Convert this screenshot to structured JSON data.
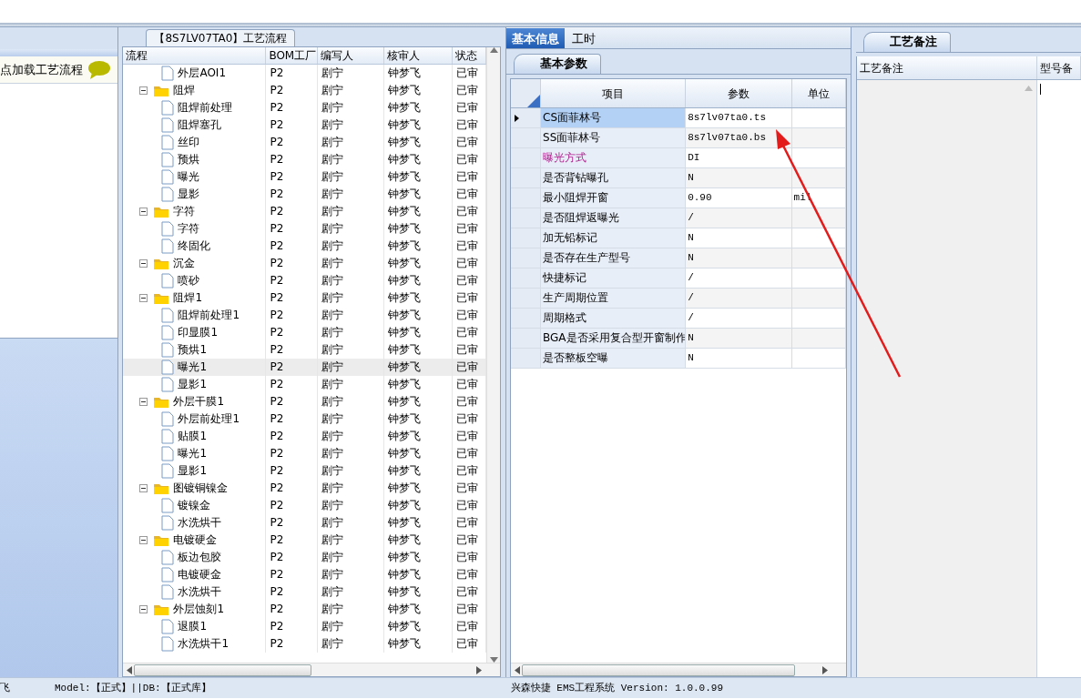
{
  "left_panel": {
    "hint": "点加载工艺流程"
  },
  "flow_panel": {
    "title": "【8S7LV07TA0】工艺流程",
    "columns": [
      "流程",
      "BOM工厂",
      "编写人",
      "核审人",
      "状态"
    ],
    "rows": [
      {
        "label": "外层AOI1",
        "kind": "leaf",
        "bom": "P2",
        "writer": "剧宁",
        "reviewer": "钟梦飞",
        "status": "已审",
        "selected": false
      },
      {
        "label": "阻焊",
        "kind": "group",
        "expanded": true,
        "bom": "P2",
        "writer": "剧宁",
        "reviewer": "钟梦飞",
        "status": "已审",
        "selected": false,
        "children": [
          {
            "label": "阻焊前处理",
            "kind": "leaf",
            "bom": "P2",
            "writer": "剧宁",
            "reviewer": "钟梦飞",
            "status": "已审",
            "selected": false
          },
          {
            "label": "阻焊塞孔",
            "kind": "leaf",
            "bom": "P2",
            "writer": "剧宁",
            "reviewer": "钟梦飞",
            "status": "已审",
            "selected": false
          },
          {
            "label": "丝印",
            "kind": "leaf",
            "bom": "P2",
            "writer": "剧宁",
            "reviewer": "钟梦飞",
            "status": "已审",
            "selected": false
          },
          {
            "label": "预烘",
            "kind": "leaf",
            "bom": "P2",
            "writer": "剧宁",
            "reviewer": "钟梦飞",
            "status": "已审",
            "selected": false
          },
          {
            "label": "曝光",
            "kind": "leaf",
            "bom": "P2",
            "writer": "剧宁",
            "reviewer": "钟梦飞",
            "status": "已审",
            "selected": false
          },
          {
            "label": "显影",
            "kind": "leaf",
            "bom": "P2",
            "writer": "剧宁",
            "reviewer": "钟梦飞",
            "status": "已审",
            "selected": false
          }
        ]
      },
      {
        "label": "字符",
        "kind": "group",
        "expanded": true,
        "bom": "P2",
        "writer": "剧宁",
        "reviewer": "钟梦飞",
        "status": "已审",
        "selected": false,
        "children": [
          {
            "label": "字符",
            "kind": "leaf",
            "bom": "P2",
            "writer": "剧宁",
            "reviewer": "钟梦飞",
            "status": "已审",
            "selected": false
          },
          {
            "label": "终固化",
            "kind": "leaf",
            "bom": "P2",
            "writer": "剧宁",
            "reviewer": "钟梦飞",
            "status": "已审",
            "selected": false
          }
        ]
      },
      {
        "label": "沉金",
        "kind": "group",
        "expanded": true,
        "bom": "P2",
        "writer": "剧宁",
        "reviewer": "钟梦飞",
        "status": "已审",
        "selected": false,
        "children": [
          {
            "label": "喷砂",
            "kind": "leaf",
            "bom": "P2",
            "writer": "剧宁",
            "reviewer": "钟梦飞",
            "status": "已审",
            "selected": false
          }
        ]
      },
      {
        "label": "阻焊1",
        "kind": "group",
        "expanded": true,
        "bom": "P2",
        "writer": "剧宁",
        "reviewer": "钟梦飞",
        "status": "已审",
        "selected": false,
        "children": [
          {
            "label": "阻焊前处理1",
            "kind": "leaf",
            "bom": "P2",
            "writer": "剧宁",
            "reviewer": "钟梦飞",
            "status": "已审",
            "selected": false
          },
          {
            "label": "印显膜1",
            "kind": "leaf",
            "bom": "P2",
            "writer": "剧宁",
            "reviewer": "钟梦飞",
            "status": "已审",
            "selected": false
          },
          {
            "label": "预烘1",
            "kind": "leaf",
            "bom": "P2",
            "writer": "剧宁",
            "reviewer": "钟梦飞",
            "status": "已审",
            "selected": false
          },
          {
            "label": "曝光1",
            "kind": "leaf",
            "bom": "P2",
            "writer": "剧宁",
            "reviewer": "钟梦飞",
            "status": "已审",
            "selected": true
          },
          {
            "label": "显影1",
            "kind": "leaf",
            "bom": "P2",
            "writer": "剧宁",
            "reviewer": "钟梦飞",
            "status": "已审",
            "selected": false
          }
        ]
      },
      {
        "label": "外层干膜1",
        "kind": "group",
        "expanded": true,
        "bom": "P2",
        "writer": "剧宁",
        "reviewer": "钟梦飞",
        "status": "已审",
        "selected": false,
        "children": [
          {
            "label": "外层前处理1",
            "kind": "leaf",
            "bom": "P2",
            "writer": "剧宁",
            "reviewer": "钟梦飞",
            "status": "已审",
            "selected": false
          },
          {
            "label": "贴膜1",
            "kind": "leaf",
            "bom": "P2",
            "writer": "剧宁",
            "reviewer": "钟梦飞",
            "status": "已审",
            "selected": false
          },
          {
            "label": "曝光1",
            "kind": "leaf",
            "bom": "P2",
            "writer": "剧宁",
            "reviewer": "钟梦飞",
            "status": "已审",
            "selected": false
          },
          {
            "label": "显影1",
            "kind": "leaf",
            "bom": "P2",
            "writer": "剧宁",
            "reviewer": "钟梦飞",
            "status": "已审",
            "selected": false
          }
        ]
      },
      {
        "label": "图镀铜镍金",
        "kind": "group",
        "expanded": true,
        "bom": "P2",
        "writer": "剧宁",
        "reviewer": "钟梦飞",
        "status": "已审",
        "selected": false,
        "children": [
          {
            "label": "镀镍金",
            "kind": "leaf",
            "bom": "P2",
            "writer": "剧宁",
            "reviewer": "钟梦飞",
            "status": "已审",
            "selected": false
          },
          {
            "label": "水洗烘干",
            "kind": "leaf",
            "bom": "P2",
            "writer": "剧宁",
            "reviewer": "钟梦飞",
            "status": "已审",
            "selected": false
          }
        ]
      },
      {
        "label": "电镀硬金",
        "kind": "group",
        "expanded": true,
        "bom": "P2",
        "writer": "剧宁",
        "reviewer": "钟梦飞",
        "status": "已审",
        "selected": false,
        "children": [
          {
            "label": "板边包胶",
            "kind": "leaf",
            "bom": "P2",
            "writer": "剧宁",
            "reviewer": "钟梦飞",
            "status": "已审",
            "selected": false
          },
          {
            "label": "电镀硬金",
            "kind": "leaf",
            "bom": "P2",
            "writer": "剧宁",
            "reviewer": "钟梦飞",
            "status": "已审",
            "selected": false
          },
          {
            "label": "水洗烘干",
            "kind": "leaf",
            "bom": "P2",
            "writer": "剧宁",
            "reviewer": "钟梦飞",
            "status": "已审",
            "selected": false
          }
        ]
      },
      {
        "label": "外层蚀刻1",
        "kind": "group",
        "expanded": true,
        "bom": "P2",
        "writer": "剧宁",
        "reviewer": "钟梦飞",
        "status": "已审",
        "selected": false,
        "children": [
          {
            "label": "退膜1",
            "kind": "leaf",
            "bom": "P2",
            "writer": "剧宁",
            "reviewer": "钟梦飞",
            "status": "已审",
            "selected": false
          },
          {
            "label": "水洗烘干1",
            "kind": "leaf",
            "bom": "P2",
            "writer": "剧宁",
            "reviewer": "钟梦飞",
            "status": "已审",
            "selected": false
          }
        ]
      }
    ]
  },
  "info_panel": {
    "tabs": [
      {
        "label": "基本信息",
        "selected": true
      },
      {
        "label": "工时",
        "selected": false
      }
    ],
    "subtabs": [
      {
        "label": "基本参数",
        "selected": true
      }
    ],
    "columns": [
      "项目",
      "参数",
      "单位"
    ],
    "rows": [
      {
        "item": "CS面菲林号",
        "value": "8s7lv07ta0.ts",
        "selected": true,
        "emphasized": false
      },
      {
        "item": "SS面菲林号",
        "value": "8s7lv07ta0.bs",
        "selected": false,
        "emphasized": false
      },
      {
        "item": "曝光方式",
        "value": "DI",
        "selected": false,
        "emphasized": true
      },
      {
        "item": "是否背钻曝孔",
        "value": "N",
        "selected": false,
        "emphasized": false
      },
      {
        "item": "最小阻焊开窗",
        "value": "0.90",
        "unit": "mil",
        "selected": false,
        "emphasized": false
      },
      {
        "item": "是否阻焊返曝光",
        "value": "/",
        "selected": false,
        "emphasized": false
      },
      {
        "item": "加无铅标记",
        "value": "N",
        "selected": false,
        "emphasized": false
      },
      {
        "item": "是否存在生产型号",
        "value": "N",
        "selected": false,
        "emphasized": false
      },
      {
        "item": "快捷标记",
        "value": "/",
        "selected": false,
        "emphasized": false
      },
      {
        "item": "生产周期位置",
        "value": "/",
        "selected": false,
        "emphasized": false
      },
      {
        "item": "周期格式",
        "value": "/",
        "selected": false,
        "emphasized": false
      },
      {
        "item": "BGA是否采用复合型开窗制作",
        "value": "N",
        "selected": false,
        "emphasized": false
      },
      {
        "item": "是否整板空曝",
        "value": "N",
        "selected": false,
        "emphasized": false
      }
    ]
  },
  "notes_panel": {
    "tabs": [
      {
        "label": "工艺备注",
        "selected": true
      }
    ],
    "columns": [
      "工艺备注",
      "型号备"
    ]
  },
  "status_bar": {
    "left": "飞",
    "model": "Model:【正式】||DB:【正式库】",
    "app": "兴森快捷 EMS工程系统 Version: 1.0.0.99"
  }
}
